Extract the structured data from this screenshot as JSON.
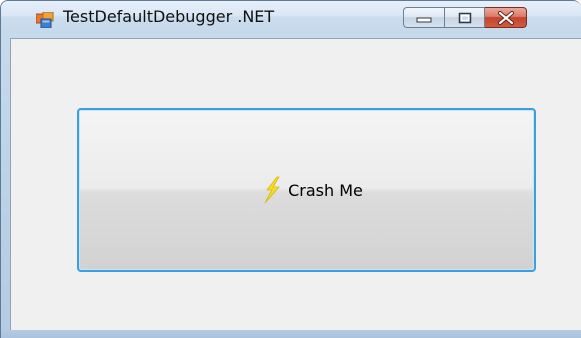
{
  "window": {
    "title": "TestDefaultDebugger .NET",
    "app_icon": "app-window-icon"
  },
  "caption_buttons": {
    "minimize_icon": "minimize-icon",
    "maximize_icon": "maximize-icon",
    "close_icon": "close-icon"
  },
  "main": {
    "button_label": "Crash Me",
    "button_icon": "lightning-bolt-icon"
  },
  "colors": {
    "focus_border": "#3c9ee0",
    "close_button": "#c6432d",
    "bolt": "#f2d400",
    "client_background": "#f0f0f0"
  }
}
